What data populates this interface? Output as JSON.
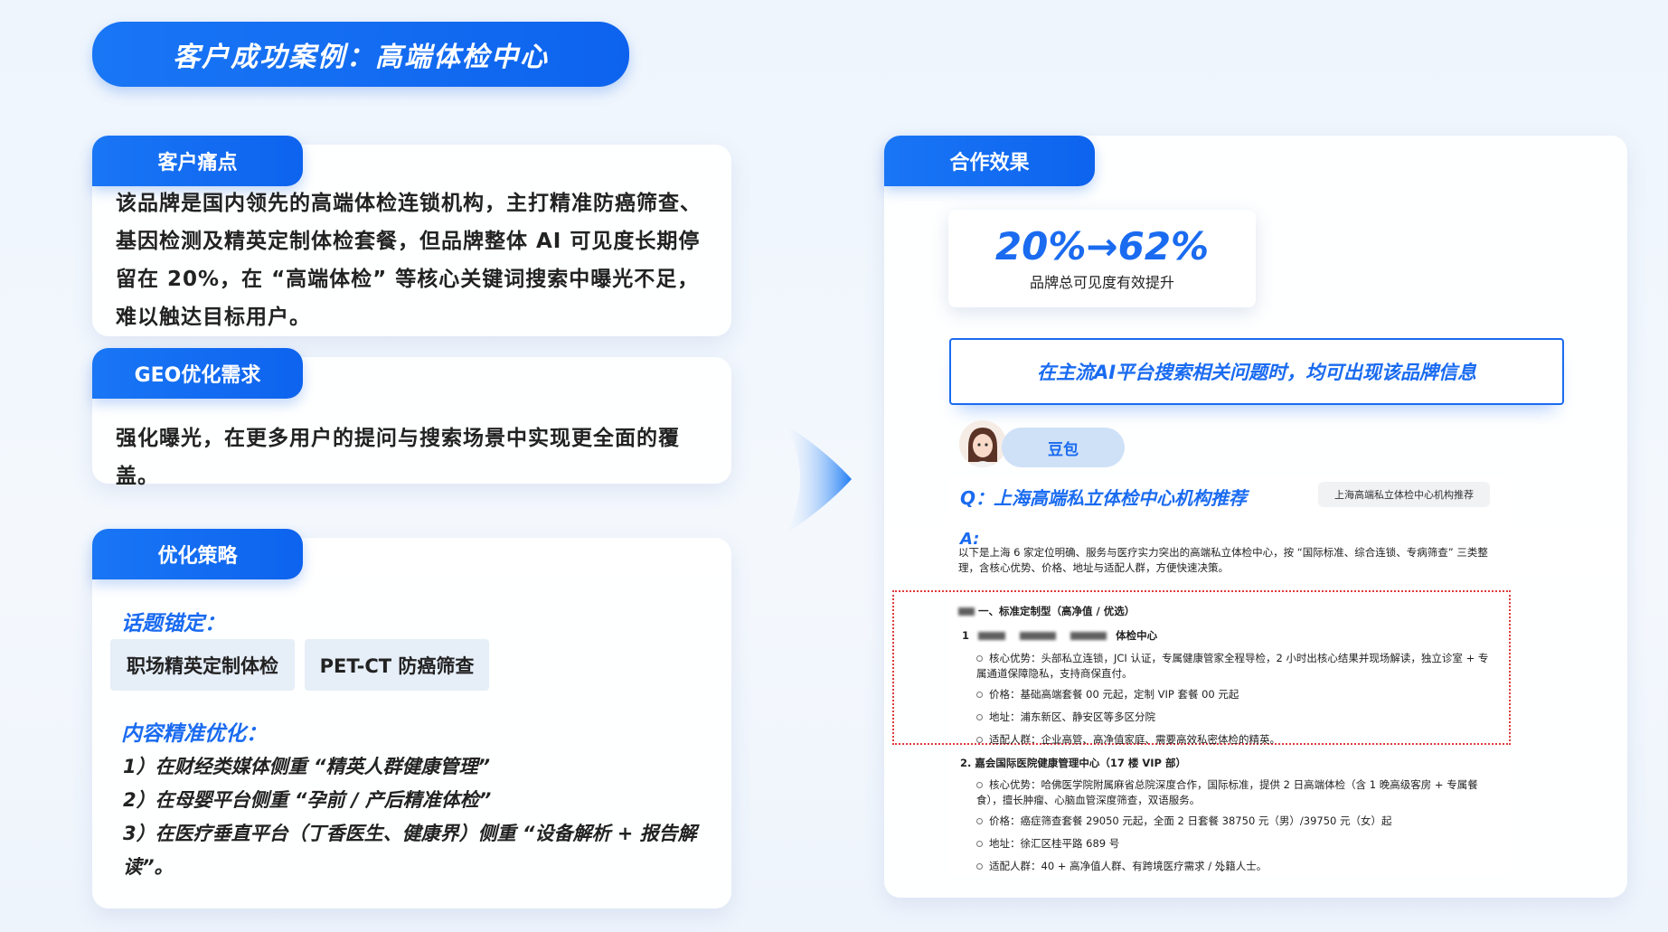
{
  "title": "客户成功案例：高端体检中心",
  "pain": {
    "label": "客户痛点",
    "text": "该品牌是国内领先的高端体检连锁机构，主打精准防癌筛查、基因检测及精英定制体检套餐，但品牌整体 AI 可见度长期停留在 20%，在 “高端体检” 等核心关键词搜索中曝光不足，难以触达目标用户。"
  },
  "geo": {
    "label": "GEO优化需求",
    "text": "强化曝光，在更多用户的提问与搜索场景中实现更全面的覆盖。"
  },
  "strategy": {
    "label": "优化策略",
    "topic_heading": "话题锚定：",
    "tags": [
      "职场精英定制体检",
      "PET-CT 防癌筛查"
    ],
    "content_heading": "内容精准优化：",
    "items": [
      "1）在财经类媒体侧重 “精英人群健康管理”",
      "2）在母婴平台侧重 “孕前 / 产后精准体检”",
      "3）在医疗垂直平台（丁香医生、健康界）侧重 “设备解析 + 报告解读”。"
    ]
  },
  "result": {
    "label": "合作效果",
    "stat": "20%→62%",
    "stat_caption": "品牌总可见度有效提升",
    "banner": "在主流AI平台搜索相关问题时，均可出现该品牌信息",
    "bot_name": "豆包",
    "question": "Q：上海高端私立体检中心机构推荐",
    "query_chip": "上海高端私立体检中心机构推荐",
    "answer_label": "A:",
    "answer_intro": "以下是上海 6 家定位明确、服务与医疗实力突出的高端私立体检中心，按 “国际标准、综合连锁、专病筛查” 三类整理，含核心优势、价格、地址与适配人群，方便快速决策。",
    "section1_heading": "一、标准定制型（高净值 / 优选）",
    "item1_name": "体检中心",
    "item1_lines": [
      "核心优势：头部私立连锁，JCI 认证，专属健康管家全程导检，2 小时出核心结果并现场解读，独立诊室 + 专属通道保障隐私，支持商保直付。",
      "价格：基础高端套餐 00 元起，定制 VIP 套餐 00 元起",
      "地址：浦东新区、静安区等多区分院",
      "适配人群：企业高管、高净值家庭、需要高效私密体检的精英。"
    ],
    "item2_name": "2. 嘉会国际医院健康管理中心（17 楼 VIP 部）",
    "item2_lines": [
      "核心优势：哈佛医学院附属麻省总院深度合作，国际标准，提供 2 日高端体检（含 1 晚高级客房 + 专属餐食），擅长肿瘤、心脑血管深度筛查，双语服务。",
      "价格：癌症筛查套餐 29050 元起，全面 2 日套餐 38750 元（男）/39750 元（女）起",
      "地址：徐汇区桂平路 689 号",
      "适配人群：40 + 高净值人群、有跨境医疗需求 / 外籍人士。"
    ]
  },
  "colors": {
    "primary": "#1a6bf0",
    "highlight_border": "#e03a3a",
    "tag_bg": "#e6eef8"
  }
}
